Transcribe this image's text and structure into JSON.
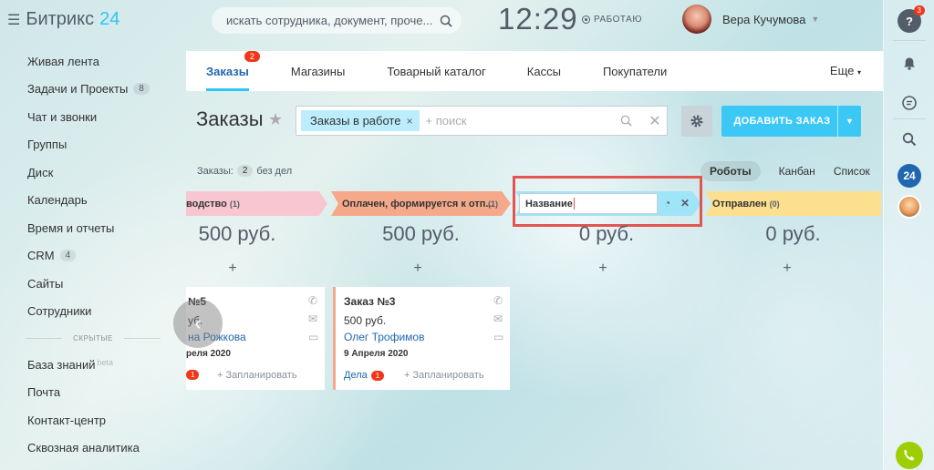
{
  "app": {
    "logo_name": "Битрикс",
    "logo_num": "24",
    "search_placeholder": "искать сотрудника, документ, проче...",
    "clock": "12:29",
    "work_status": "РАБОТАЮ",
    "user_name": "Вера Кучумова"
  },
  "sidebar": {
    "items": [
      {
        "label": "Живая лента"
      },
      {
        "label": "Задачи и Проекты",
        "count": "8"
      },
      {
        "label": "Чат и звонки"
      },
      {
        "label": "Группы"
      },
      {
        "label": "Диск"
      },
      {
        "label": "Календарь"
      },
      {
        "label": "Время и отчеты"
      },
      {
        "label": "CRM",
        "count": "4"
      },
      {
        "label": "Сайты"
      },
      {
        "label": "Сотрудники"
      }
    ],
    "hidden_label": "СКРЫТЫЕ",
    "hidden_items": [
      {
        "label": "База знаний",
        "suffix": "beta"
      },
      {
        "label": "Почта"
      },
      {
        "label": "Контакт-центр"
      },
      {
        "label": "Сквозная аналитика"
      }
    ]
  },
  "rightbar": {
    "help_badge": "3",
    "bitrix_label": "24"
  },
  "tabs": {
    "items": [
      {
        "label": "Заказы",
        "badge": "2"
      },
      {
        "label": "Магазины"
      },
      {
        "label": "Товарный каталог"
      },
      {
        "label": "Кассы"
      },
      {
        "label": "Покупатели"
      }
    ],
    "more": "Еще"
  },
  "page": {
    "title": "Заказы",
    "filter_chip": "Заказы в работе",
    "filter_placeholder": "+ поиск",
    "add_button": "ДОБАВИТЬ ЗАКАЗ",
    "counter_label": "Заказы:",
    "counter_value": "2",
    "counter_suffix": "без дел",
    "views": [
      "Роботы",
      "Канбан",
      "Список"
    ]
  },
  "columns": [
    {
      "title": "водство",
      "count": "(1)",
      "sum": "500 руб."
    },
    {
      "title": "Оплачен, формируется к отп...",
      "count": "(1)",
      "sum": "500 руб."
    },
    {
      "title_input": "Название",
      "sum": "0 руб."
    },
    {
      "title": "Отправлен",
      "count": "(0)",
      "sum": "0 руб."
    }
  ],
  "cards": [
    {
      "title": "№5",
      "price": "уб.",
      "user": "на Рожкова",
      "date": "реля 2020",
      "deals_badge": "1",
      "plan": "+ Запланировать"
    },
    {
      "title": "Заказ №3",
      "price": "500 руб.",
      "user": "Олег Трофимов",
      "date": "9 Апреля 2020",
      "deals_label": "Дела",
      "deals_badge": "1",
      "plan": "+ Запланировать"
    }
  ],
  "colors": {
    "accent": "#2fc6f6",
    "link": "#2067b0",
    "badge": "#f0371b",
    "stage_pink": "#f7c6d0",
    "stage_orange": "#f5a98a",
    "stage_blue": "#9fe4f7",
    "stage_yellow": "#fde08f",
    "highlight": "#e5554f"
  }
}
